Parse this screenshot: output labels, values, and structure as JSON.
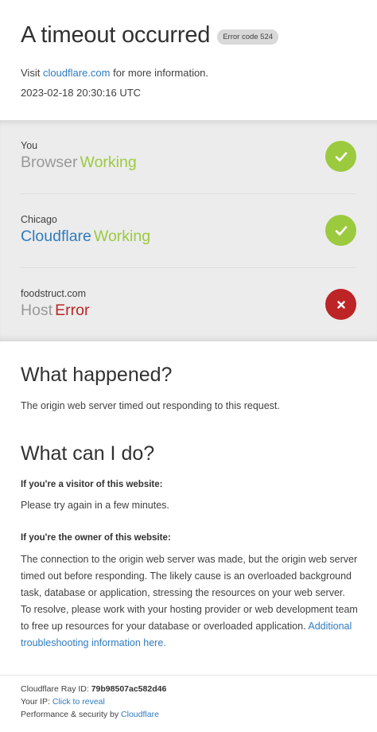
{
  "header": {
    "title": "A timeout occurred",
    "error_badge": "Error code 524",
    "visit_prefix": "Visit ",
    "visit_link": "cloudflare.com",
    "visit_suffix": " for more information.",
    "timestamp": "2023-02-18 20:30:16 UTC"
  },
  "status": [
    {
      "location": "You",
      "service": "Browser",
      "state": "Working",
      "icon": "checkmark-icon"
    },
    {
      "location": "Chicago",
      "service": "Cloudflare",
      "state": "Working",
      "icon": "checkmark-icon"
    },
    {
      "location": "foodstruct.com",
      "service": "Host",
      "state": "Error",
      "icon": "close-x-icon"
    }
  ],
  "what_happened": {
    "title": "What happened?",
    "text": "The origin web server timed out responding to this request."
  },
  "what_can_i_do": {
    "title": "What can I do?",
    "visitor_label": "If you're a visitor of this website:",
    "visitor_text": "Please try again in a few minutes.",
    "owner_label": "If you're the owner of this website:",
    "owner_text": "The connection to the origin web server was made, but the origin web server timed out before responding. The likely cause is an overloaded background task, database or application, stressing the resources on your web server. To resolve, please work with your hosting provider or web development team to free up resources for your database or overloaded application.",
    "owner_link": "Additional troubleshooting information here."
  },
  "footer": {
    "ray_label": "Cloudflare Ray ID: ",
    "ray_id": "79b98507ac582d46",
    "ip_label": "Your IP: ",
    "ip_link": "Click to reveal",
    "perf_label": "Performance & security by ",
    "perf_link": "Cloudflare"
  },
  "colors": {
    "working": "#9bca3e",
    "error": "#bd2426",
    "link": "#2f7bbf"
  }
}
